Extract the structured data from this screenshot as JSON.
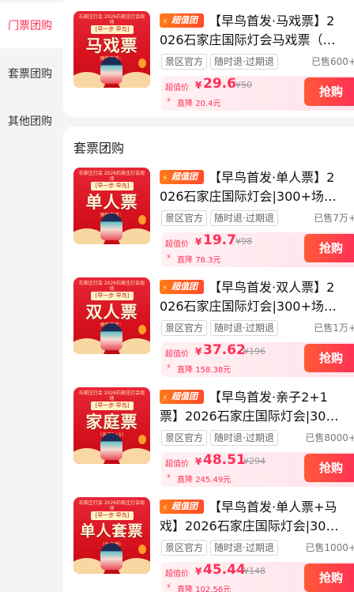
{
  "sidebar": {
    "items": [
      {
        "label": "门票团购",
        "active": true
      },
      {
        "label": "套票团购",
        "active": false
      },
      {
        "label": "其他团购",
        "active": false
      }
    ]
  },
  "section_title": "套票团购",
  "super_tag": "超值团",
  "chips": [
    "景区官方",
    "随时退·过期退"
  ],
  "price_label": "超值价",
  "currency": "¥",
  "buy_label": "抢购",
  "drop_prefix": "直降",
  "thumb_caption": "石家庄灯会 2026石家庄灯会现场",
  "thumb_badge": "[早一步 早鸟]",
  "products": [
    {
      "thumb_text": "马戏票",
      "thumb_sub": "预约电话：",
      "title_l1": "【早鸟首发·马戏票】2",
      "title_l2": "026石家庄国际灯会马戏票（…",
      "sold": "已售600+",
      "price": "29.6",
      "orig": "¥50",
      "drop": "20.4元"
    },
    {
      "thumb_text": "单人票",
      "thumb_sub": "预约电话：",
      "title_l1": "【早鸟首发·单人票】2",
      "title_l2": "026石家庄国际灯会|300+场…",
      "sold": "已售7万+",
      "price": "19.7",
      "orig": "¥98",
      "drop": "78.3元"
    },
    {
      "thumb_text": "双人票",
      "thumb_sub": "预约电话：",
      "title_l1": "【早鸟首发·双人票】2",
      "title_l2": "026石家庄国际灯会|300+场…",
      "sold": "已售1万+",
      "price": "37.62",
      "orig": "¥196",
      "drop": "158.38元"
    },
    {
      "thumb_text": "家庭票",
      "thumb_sub": "（亲子2+1）",
      "title_l1": "【早鸟首发·亲子2+1",
      "title_l2": "票】2026石家庄国际灯会|30…",
      "sold": "已售8000+",
      "price": "48.51",
      "orig": "¥294",
      "drop": "245.49元"
    },
    {
      "thumb_text": "单人套票",
      "thumb_sub": "（含马戏）",
      "title_l1": "【早鸟首发·单人票+马",
      "title_l2": "戏】2026石家庄国际灯会|30…",
      "sold": "已售1000+",
      "price": "45.44",
      "orig": "¥148",
      "drop": "102.56元"
    }
  ],
  "colors": {
    "accent": "#ff2f56",
    "orange": "#ff5a36",
    "thumb_red": "#d7121e"
  }
}
